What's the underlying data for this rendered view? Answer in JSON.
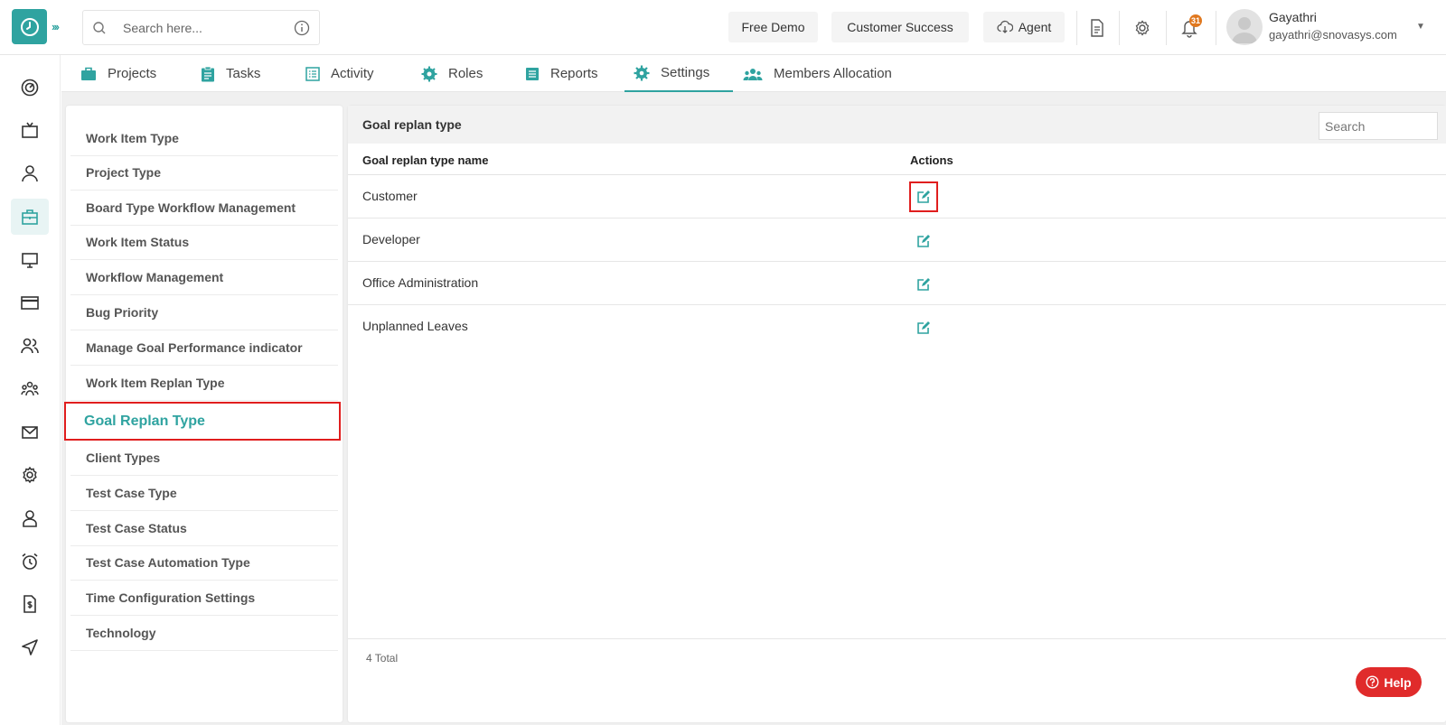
{
  "header": {
    "search_placeholder": "Search here...",
    "buttons": [
      "Free Demo",
      "Customer Success",
      "Agent"
    ],
    "notification_count": "31",
    "user": {
      "name": "Gayathri",
      "email": "gayathri@snovasys.com"
    }
  },
  "tabs": [
    "Projects",
    "Tasks",
    "Activity",
    "Roles",
    "Reports",
    "Settings",
    "Members Allocation"
  ],
  "active_tab": "Settings",
  "settings_menu": [
    "Work Item Type",
    "Project Type",
    "Board Type Workflow Management",
    "Work Item Status",
    "Workflow Management",
    "Bug Priority",
    "Manage Goal Performance indicator",
    "Work Item Replan Type",
    "Goal Replan Type",
    "Client Types",
    "Test Case Type",
    "Test Case Status",
    "Test Case Automation Type",
    "Time Configuration Settings",
    "Technology"
  ],
  "active_menu_item": "Goal Replan Type",
  "panel": {
    "title": "Goal replan type",
    "search_placeholder": "Search",
    "columns": [
      "Goal replan type name",
      "Actions"
    ],
    "rows": [
      "Customer",
      "Developer",
      "Office Administration",
      "Unplanned Leaves"
    ],
    "total": "4 Total"
  },
  "help_label": "Help",
  "colors": {
    "accent": "#2fa3a0",
    "highlight": "#e01e1e",
    "help": "#e02b2b",
    "badge": "#e0781f"
  }
}
